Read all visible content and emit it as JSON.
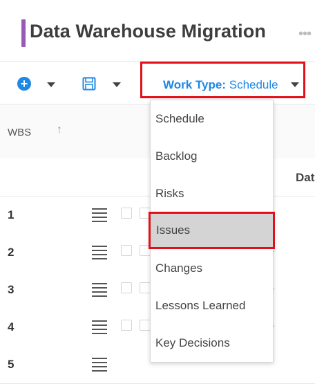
{
  "header": {
    "title": "Data Warehouse Migration",
    "accent_color": "#9b59b6",
    "more_icon": "ellipsis-icon"
  },
  "toolbar": {
    "add_icon": "plus-circle-icon",
    "save_icon": "floppy-disk-icon",
    "work_type_label": "Work Type:",
    "work_type_value": "Schedule",
    "accent_color": "#1e88e5",
    "highlight_color": "#e3101a"
  },
  "grid": {
    "columns": {
      "wbs": "WBS",
      "date_partial": "Dat"
    },
    "rows": [
      {
        "wbs": "1"
      },
      {
        "wbs": "2"
      },
      {
        "wbs": "3"
      },
      {
        "wbs": "4"
      },
      {
        "wbs": "5"
      }
    ]
  },
  "dropdown": {
    "items": [
      {
        "label": "Schedule"
      },
      {
        "label": "Backlog"
      },
      {
        "label": "Risks"
      },
      {
        "label": "Issues"
      },
      {
        "label": "Changes"
      },
      {
        "label": "Lessons Learned"
      },
      {
        "label": "Key Decisions"
      }
    ],
    "hovered_item": "Issues"
  }
}
